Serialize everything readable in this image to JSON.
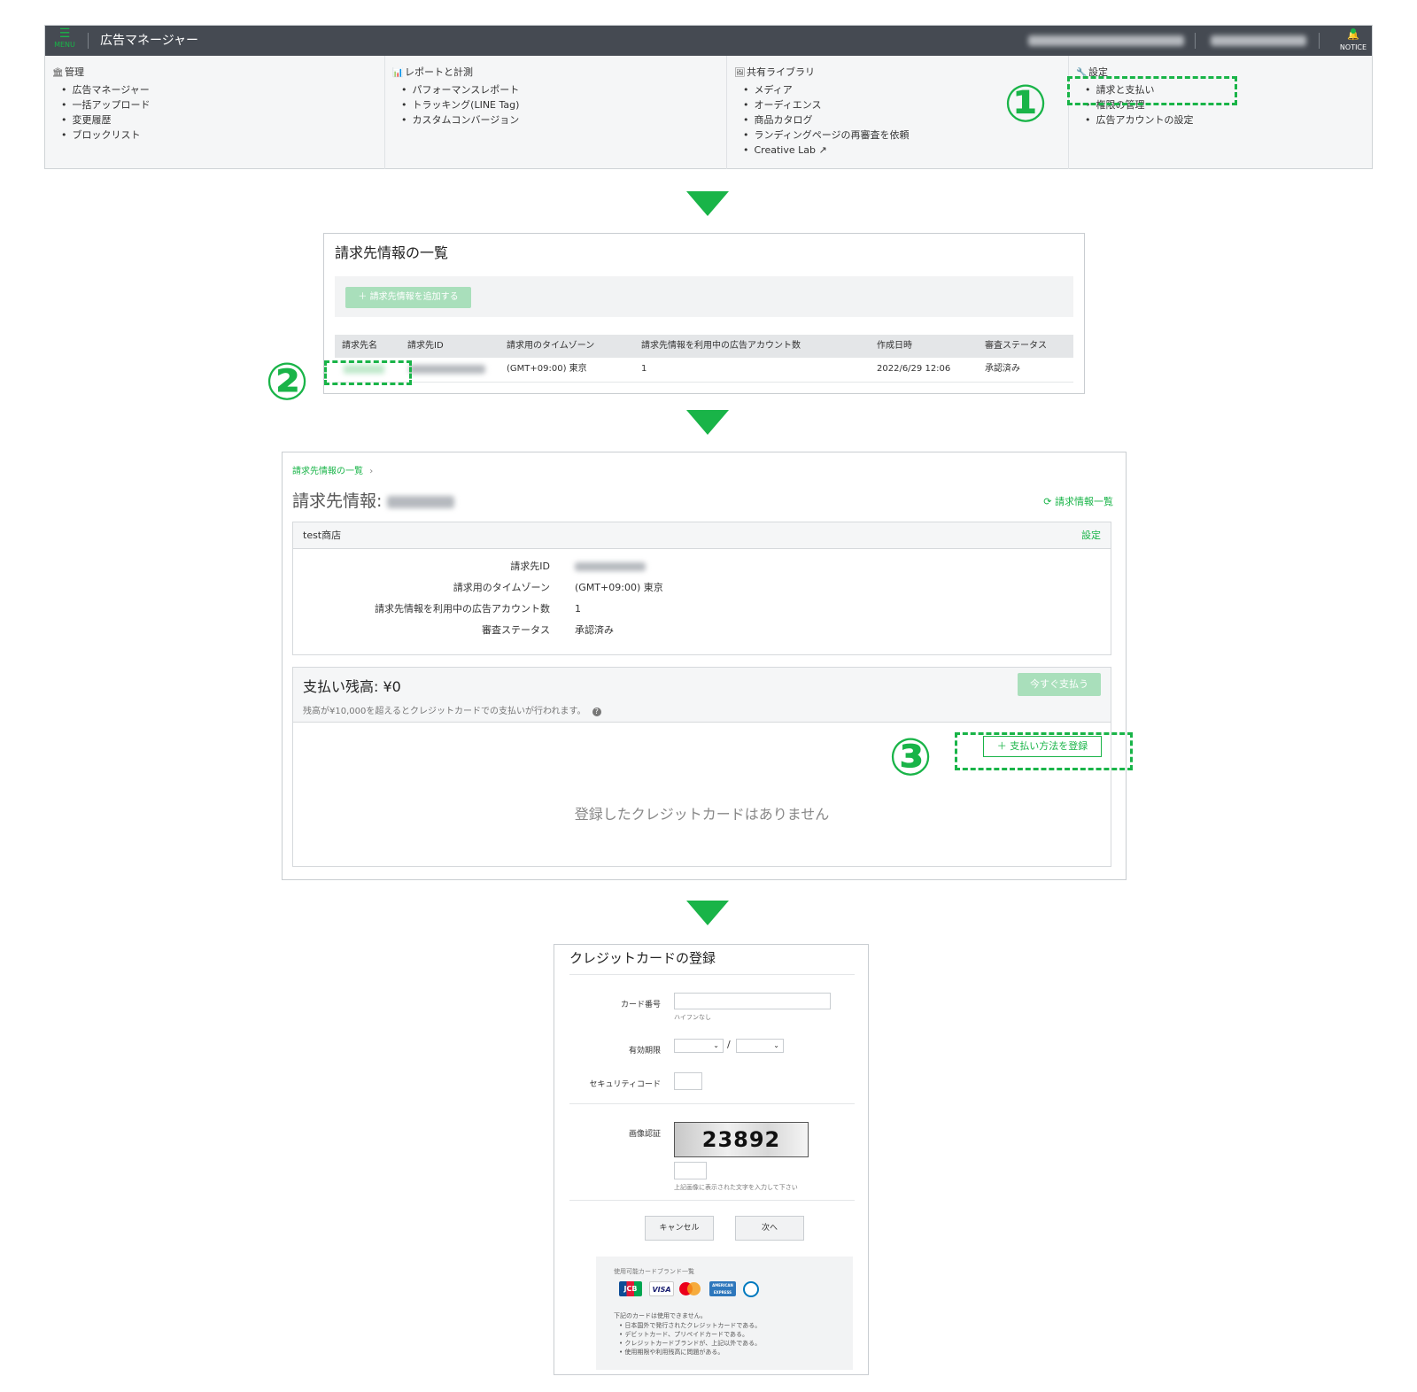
{
  "colors": {
    "accent": "#19b448",
    "topbar": "#454a52",
    "light_button": "#a9dfbb"
  },
  "step1": {
    "menu_label": "MENU",
    "app_title": "広告マネージャー",
    "notice_label": "NOTICE",
    "annotation": "①",
    "columns": [
      {
        "icon": "bank-icon",
        "title": "管理",
        "items": [
          "広告マネージャー",
          "一括アップロード",
          "変更履歴",
          "ブロックリスト"
        ]
      },
      {
        "icon": "bar-chart-icon",
        "title": "レポートと計測",
        "items": [
          "パフォーマンスレポート",
          "トラッキング(LINE Tag)",
          "カスタムコンバージョン"
        ]
      },
      {
        "icon": "image-icon",
        "title": "共有ライブラリ",
        "items": [
          "メディア",
          "オーディエンス",
          "商品カタログ",
          "ランディングページの再審査を依頼",
          "Creative Lab"
        ]
      },
      {
        "icon": "wrench-icon",
        "title": "設定",
        "items": [
          "請求と支払い",
          "権限の管理",
          "広告アカウントの設定"
        ]
      }
    ]
  },
  "step2": {
    "title": "請求先情報の一覧",
    "add_button": "＋ 請求先情報を追加する",
    "annotation": "②",
    "headers": [
      "請求先名",
      "請求先ID",
      "請求用のタイムゾーン",
      "請求先情報を利用中の広告アカウント数",
      "作成日時",
      "審査ステータス"
    ],
    "row": {
      "timezone": "(GMT+09:00) 東京",
      "accounts": "1",
      "created": "2022/6/29 12:06",
      "status": "承認済み"
    }
  },
  "step3": {
    "breadcrumb": "請求先情報の一覧",
    "breadcrumb_sep": "›",
    "title": "請求先情報:",
    "refresh_link": "請求情報一覧",
    "shop_name": "test商店",
    "settings_link": "設定",
    "details": [
      {
        "key": "請求先ID",
        "value": ""
      },
      {
        "key": "請求用のタイムゾーン",
        "value": "(GMT+09:00) 東京"
      },
      {
        "key": "請求先情報を利用中の広告アカウント数",
        "value": "1"
      },
      {
        "key": "審査ステータス",
        "value": "承認済み"
      }
    ],
    "balance": "支払い残高: ¥0",
    "pay_now": "今すぐ支払う",
    "note": "残高が¥10,000を超えるとクレジットカードでの支払いが行われます。",
    "add_payment": "＋ 支払い方法を登録",
    "empty": "登録したクレジットカードはありません",
    "annotation": "③"
  },
  "step4": {
    "title": "クレジットカードの登録",
    "card_number_label": "カード番号",
    "card_number_hint": "ハイフンなし",
    "expiry_label": "有効期限",
    "expiry_sep": "/",
    "security_label": "セキュリティコード",
    "captcha_label": "画像認証",
    "captcha_text": "23892",
    "captcha_hint": "上記画像に表示された文字を入力して下さい",
    "cancel": "キャンセル",
    "next": "次へ",
    "brands_title": "使用可能カードブランド一覧",
    "brands": [
      "JCB",
      "VISA",
      "Mastercard",
      "AMERICAN EXPRESS",
      "Diners Club"
    ],
    "rules_title": "下記のカードは使用できません。",
    "rules": [
      "日本国外で発行されたクレジットカードである。",
      "デビットカード、プリペイドカードである。",
      "クレジットカードブランドが、上記以外である。",
      "使用期限や利用残高に問題がある。"
    ]
  }
}
